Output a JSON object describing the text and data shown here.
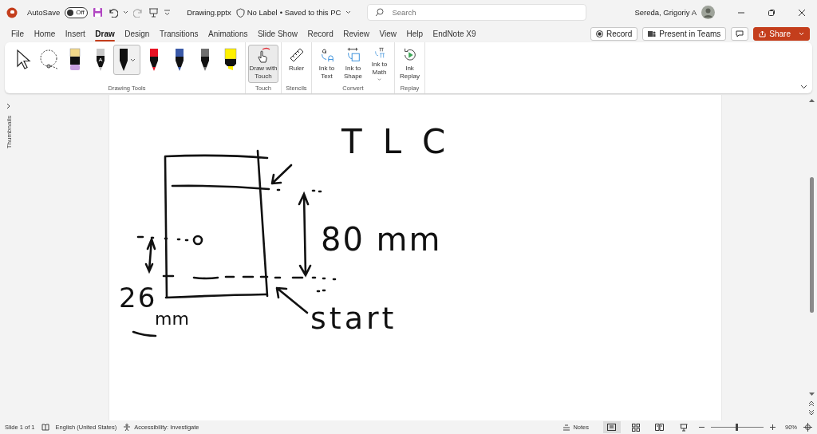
{
  "title_bar": {
    "autosave_label": "AutoSave",
    "autosave_state": "Off",
    "autosave_on": false,
    "file_name": "Drawing.pptx",
    "sensitivity": "No Label",
    "save_status": "• Saved to this PC",
    "search_placeholder": "Search",
    "user_name": "Sereda, Grigoriy A"
  },
  "menu_tabs": [
    {
      "label": "File",
      "selected": false
    },
    {
      "label": "Home",
      "selected": false
    },
    {
      "label": "Insert",
      "selected": false
    },
    {
      "label": "Draw",
      "selected": true
    },
    {
      "label": "Design",
      "selected": false
    },
    {
      "label": "Transitions",
      "selected": false
    },
    {
      "label": "Animations",
      "selected": false
    },
    {
      "label": "Slide Show",
      "selected": false
    },
    {
      "label": "Record",
      "selected": false
    },
    {
      "label": "Review",
      "selected": false
    },
    {
      "label": "View",
      "selected": false
    },
    {
      "label": "Help",
      "selected": false
    },
    {
      "label": "EndNote X9",
      "selected": false
    }
  ],
  "actions": {
    "record": "Record",
    "present": "Present in Teams",
    "share": "Share"
  },
  "ribbon": {
    "drawing_tools": [
      {
        "kind": "select",
        "selected": false
      },
      {
        "kind": "lasso",
        "selected": false
      },
      {
        "kind": "eraser",
        "selected": false
      },
      {
        "kind": "action-pen",
        "selected": false
      },
      {
        "kind": "pen",
        "color": "#111111",
        "selected": true
      },
      {
        "kind": "pen",
        "color": "#e81123",
        "selected": false
      },
      {
        "kind": "pen",
        "color": "#3b5aa8",
        "selected": false
      },
      {
        "kind": "pen",
        "color": "#6e6e6e",
        "selected": false
      },
      {
        "kind": "highlighter",
        "color": "#fff100",
        "selected": false
      }
    ],
    "drawing_tools_label": "Drawing Tools",
    "groups": [
      {
        "label": "Touch",
        "buttons": [
          {
            "kind": "touch",
            "label": "Draw with Touch",
            "on": true
          }
        ]
      },
      {
        "label": "Stencils",
        "buttons": [
          {
            "kind": "ruler",
            "label": "Ruler",
            "on": false
          }
        ]
      },
      {
        "label": "Convert",
        "buttons": [
          {
            "kind": "ink-text",
            "label": "Ink to Text",
            "on": false
          },
          {
            "kind": "ink-shape",
            "label": "Ink to Shape",
            "on": false
          },
          {
            "kind": "ink-math",
            "label": "Ink to Math",
            "on": false
          }
        ]
      },
      {
        "label": "Replay",
        "buttons": [
          {
            "kind": "replay",
            "label": "Ink Replay",
            "on": false
          }
        ]
      }
    ]
  },
  "thumbnails_label": "Thumbnails",
  "slide": {
    "ink_texts": [
      {
        "text": "TLC"
      },
      {
        "text": "80 mm"
      },
      {
        "text": "26"
      },
      {
        "text": "mm"
      },
      {
        "text": "start"
      }
    ]
  },
  "status_bar": {
    "slide_count": "Slide 1 of 1",
    "language": "English (United States)",
    "accessibility": "Accessibility: Investigate",
    "notes": "Notes",
    "zoom": "90%",
    "zoom_slider": {
      "level": 0.5
    }
  }
}
